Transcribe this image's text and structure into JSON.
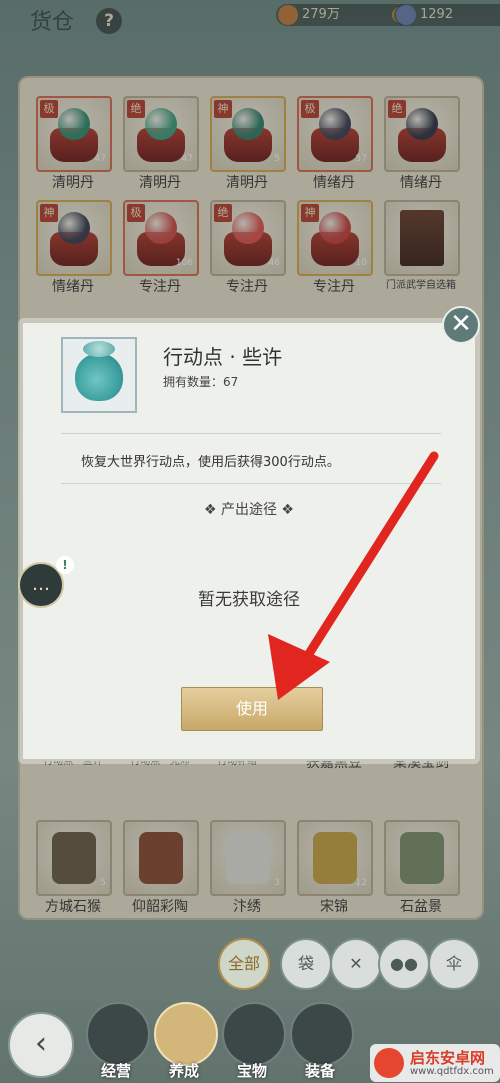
{
  "header": {
    "title": "货仓",
    "help_label": "?",
    "coins": {
      "value": "279万",
      "color": "#c47a3a"
    },
    "jade": {
      "value": "1292",
      "color": "#6a7fb0"
    },
    "plus": "+"
  },
  "items": [
    {
      "name": "清明丹",
      "tag": "极",
      "count": "47",
      "orb": "#2f8c6f"
    },
    {
      "name": "清明丹",
      "tag": "绝",
      "count": "47",
      "orb": "#3ca07f"
    },
    {
      "name": "清明丹",
      "tag": "神",
      "count": "5",
      "orb": "#2d7f66"
    },
    {
      "name": "情绪丹",
      "tag": "极",
      "count": "57",
      "orb": "#3b3f52"
    },
    {
      "name": "情绪丹",
      "tag": "绝",
      "count": "",
      "orb": "#2e3345"
    },
    {
      "name": "情绪丹",
      "tag": "神",
      "count": "",
      "orb": "#3a3a4e"
    },
    {
      "name": "专注丹",
      "tag": "极",
      "count": "106",
      "orb": "#d24a45"
    },
    {
      "name": "专注丹",
      "tag": "绝",
      "count": "46",
      "orb": "#e0524e"
    },
    {
      "name": "专注丹",
      "tag": "神",
      "count": "10",
      "orb": "#c93e3c"
    },
    {
      "name": "门派武学自选箱",
      "tag": "",
      "count": "",
      "orb": ""
    },
    {
      "name": "行动点 · 些许",
      "tag": "",
      "count": "67",
      "orb": "#56b4ae"
    },
    {
      "name": "行动点 · 充沛",
      "tag": "",
      "count": "",
      "orb": "#4aa9a4"
    },
    {
      "name": "行动补给 · 一",
      "tag": "",
      "count": "",
      "orb": "#59b5a6"
    },
    {
      "name": "获嘉黑豆",
      "tag": "",
      "count": "",
      "orb": "#2c2c2c"
    },
    {
      "name": "棠溪宝剑",
      "tag": "",
      "count": "",
      "orb": "#6d7170"
    },
    {
      "name": "方城石猴",
      "tag": "",
      "count": "5",
      "orb": "#6b5a45"
    },
    {
      "name": "仰韶彩陶",
      "tag": "",
      "count": "",
      "orb": "#8a4a2f"
    },
    {
      "name": "汴绣",
      "tag": "",
      "count": "3",
      "orb": "#e8e5dd"
    },
    {
      "name": "宋锦",
      "tag": "",
      "count": "12",
      "orb": "#c9a443"
    },
    {
      "name": "石盆景",
      "tag": "",
      "count": "",
      "orb": "#7d8f6a"
    }
  ],
  "modal": {
    "title": "行动点 · 些许",
    "quantity_label": "拥有数量：67",
    "description": "恢复大世界行动点，使用后获得300行动点。",
    "source_heading": "❖  产出途径  ❖",
    "no_source": "暂无获取途径",
    "use_button": "使用",
    "close": "✕"
  },
  "side_bubble": {
    "icon": "…",
    "badge": "!"
  },
  "filters": [
    {
      "label": "全部",
      "active": true
    },
    {
      "label": "袋",
      "active": false
    },
    {
      "label": "✕",
      "active": false
    },
    {
      "label": "●●",
      "active": false
    },
    {
      "label": "伞",
      "active": false
    }
  ],
  "nav": {
    "back": "‹",
    "tabs": [
      {
        "label": "经营",
        "active": false
      },
      {
        "label": "养成",
        "active": true
      },
      {
        "label": "宝物",
        "active": false
      },
      {
        "label": "装备",
        "active": false
      }
    ]
  },
  "watermark": {
    "title": "启东安卓网",
    "url": "www.qdtfdx.com"
  }
}
